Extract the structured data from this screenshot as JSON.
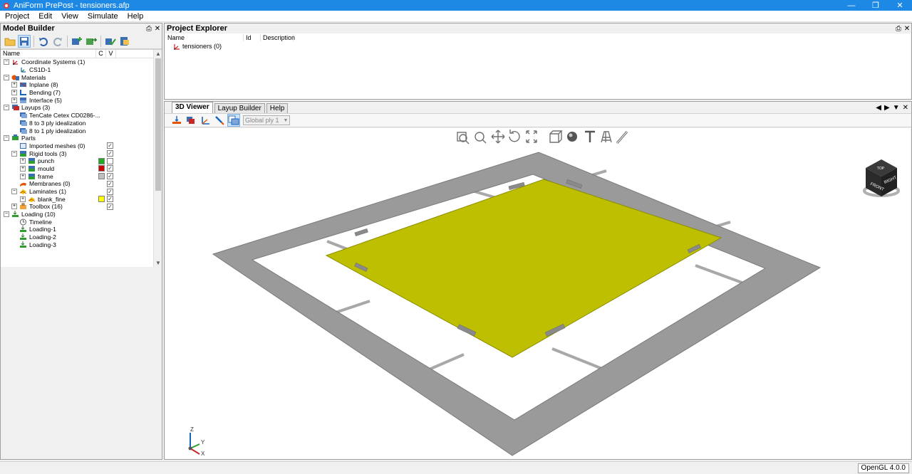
{
  "window": {
    "title": "AniForm PrePost - tensioners.afp"
  },
  "menu": [
    "Project",
    "Edit",
    "View",
    "Simulate",
    "Help"
  ],
  "model_builder": {
    "title": "Model Builder",
    "columns": {
      "name": "Name",
      "c": "C",
      "v": "V"
    },
    "tree": [
      {
        "label": "Coordinate Systems (1)",
        "icon": "coordinate-systems-icon"
      },
      {
        "label": "CS1D-1",
        "icon": "coordinate-system-icon"
      },
      {
        "label": "Materials",
        "icon": "materials-icon"
      },
      {
        "label": "Inplane (8)",
        "icon": "inplane-icon"
      },
      {
        "label": "Bending (7)",
        "icon": "bending-icon"
      },
      {
        "label": "Interface (5)",
        "icon": "interface-icon"
      },
      {
        "label": "Layups (3)",
        "icon": "layups-icon"
      },
      {
        "label": "TenCate Cetex CD0286-...",
        "icon": "layup-icon"
      },
      {
        "label": "8 to 3 ply idealization",
        "icon": "layup-icon"
      },
      {
        "label": "8 to 1 ply idealization",
        "icon": "layup-icon"
      },
      {
        "label": "Parts",
        "icon": "parts-icon"
      },
      {
        "label": "Imported meshes (0)",
        "icon": "imported-mesh-icon"
      },
      {
        "label": "Rigid tools (3)",
        "icon": "rigid-tools-icon"
      },
      {
        "label": "punch",
        "icon": "rigid-tool-icon",
        "color": "#22aa22"
      },
      {
        "label": "mould",
        "icon": "rigid-tool-icon",
        "color": "#cc0000"
      },
      {
        "label": "frame",
        "icon": "rigid-tool-icon",
        "color": "#c0c0c0"
      },
      {
        "label": "Membranes (0)",
        "icon": "membranes-icon"
      },
      {
        "label": "Laminates (1)",
        "icon": "laminates-icon"
      },
      {
        "label": "blank_fine",
        "icon": "laminate-icon",
        "color": "#ffff00"
      },
      {
        "label": "Toolbox (16)",
        "icon": "toolbox-icon"
      },
      {
        "label": "Loading (10)",
        "icon": "loading-icon"
      },
      {
        "label": "Timeline",
        "icon": "timeline-icon"
      },
      {
        "label": "Loading-1",
        "icon": "loading-step-icon"
      },
      {
        "label": "Loading-2",
        "icon": "loading-step-icon"
      },
      {
        "label": "Loading-3",
        "icon": "loading-step-icon"
      }
    ]
  },
  "project_explorer": {
    "title": "Project Explorer",
    "columns": {
      "name": "Name",
      "id": "Id",
      "description": "Description"
    },
    "item": "tensioners (0)"
  },
  "viewer": {
    "tabs": [
      "3D Viewer",
      "Layup Builder",
      "Help"
    ],
    "active_tab": "3D Viewer",
    "ply_select": "Global ply 1",
    "view_cube": {
      "front": "FRONT",
      "right": "RIGHT",
      "top": "TOP"
    },
    "axes": {
      "x": "X",
      "y": "Y",
      "z": "Z"
    },
    "colors": {
      "frame": "#9a9a9a",
      "blank": "#bdbf00",
      "tensioner": "#a8a8a8"
    }
  },
  "status": {
    "opengl": "OpenGL 4.0.0"
  }
}
